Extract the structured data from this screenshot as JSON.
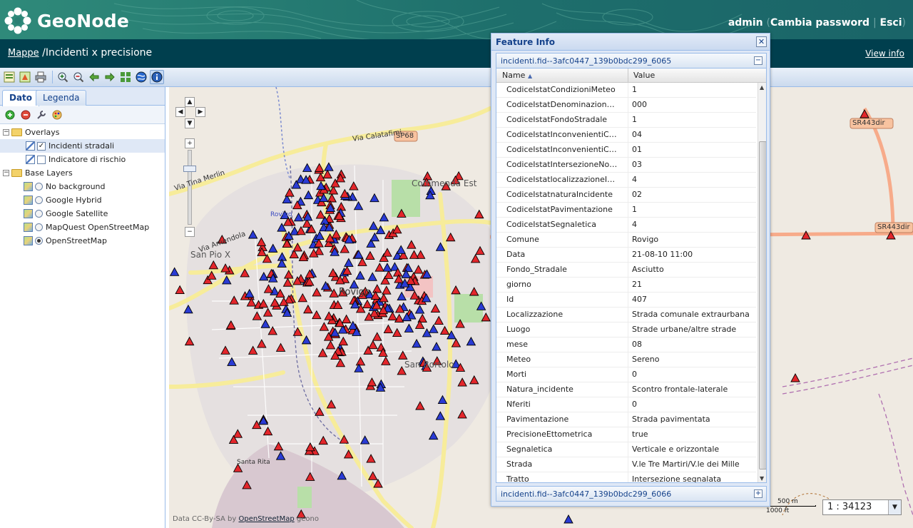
{
  "app": {
    "logo_text": "GeoNode",
    "user": "admin",
    "change_password": "Cambia password",
    "logout": "Esci"
  },
  "titlebar": {
    "breadcrumb_link": "Mappe",
    "separator": "/",
    "map_title": "Incidenti x precisione",
    "view_info": "View info"
  },
  "toolbar": {
    "buttons": [
      "print-preview",
      "export",
      "print",
      "zoom-in",
      "zoom-out",
      "back",
      "forward",
      "zoom-extent",
      "globe",
      "info"
    ]
  },
  "left_panel": {
    "tabs": [
      {
        "label": "Dato"
      },
      {
        "label": "Legenda"
      }
    ],
    "active_tab": "Dato",
    "tree": {
      "overlays_label": "Overlays",
      "overlays": [
        {
          "label": "Incidenti stradali",
          "checked": true
        },
        {
          "label": "Indicatore di rischio",
          "checked": false
        }
      ],
      "base_label": "Base Layers",
      "base": [
        {
          "label": "No background",
          "selected": false
        },
        {
          "label": "Google Hybrid",
          "selected": false
        },
        {
          "label": "Google Satellite",
          "selected": false
        },
        {
          "label": "MapQuest OpenStreetMap",
          "selected": false
        },
        {
          "label": "OpenStreetMap",
          "selected": true
        }
      ]
    }
  },
  "map": {
    "labels": {
      "via_calatafimi": "Via Calatafimi",
      "sp68": "SP68",
      "commenda_est": "Commenda Est",
      "via_merlin": "Via Tina Merlin",
      "rovigo_small": "Rovigo",
      "san_pio_x": "San Pio X",
      "rovigo": "Rovigo",
      "san_bortolo": "San Bortolo",
      "santa_rita": "Santa Rita",
      "sr443dir": "SR443dir",
      "sr443dir_2": "SR443dir",
      "amendola": "Via Amendola"
    },
    "attribution_prefix": "Data CC-By-SA by",
    "attribution_link": "OpenStreetMap",
    "attribution_suffix": "geono",
    "scale_m": "500 m",
    "scale_ft": "1000 ft",
    "scale_value": "1 : 34123",
    "colors": {
      "red_marker": "#e3262b",
      "blue_marker": "#2a3bd4"
    }
  },
  "feature_info": {
    "title": "Feature Info",
    "feature_1": "incidenti.fid--3afc0447_139b0bdc299_6065",
    "feature_2": "incidenti.fid--3afc0447_139b0bdc299_6066",
    "col_name": "Name",
    "col_value": "Value",
    "rows": [
      {
        "name": "CodiceIstatCondizioniMeteo",
        "value": "1"
      },
      {
        "name": "CodiceIstatDenominazioneStrada",
        "value": "000"
      },
      {
        "name": "CodiceIstatFondoStradale",
        "value": "1"
      },
      {
        "name": "CodiceIstatInconvenientiCircola…",
        "value": "04"
      },
      {
        "name": "CodiceIstatInconvenientiCircola…",
        "value": "01"
      },
      {
        "name": "CodiceIstatIntersezioneNonInter…",
        "value": "03"
      },
      {
        "name": "CodiceIstatlocalizzazioneIncidente",
        "value": "4"
      },
      {
        "name": "CodiceIstatnaturaIncidente",
        "value": "02"
      },
      {
        "name": "CodiceIstatPavimentazione",
        "value": "1"
      },
      {
        "name": "CodiceIstatSegnaletica",
        "value": "4"
      },
      {
        "name": "Comune",
        "value": "Rovigo"
      },
      {
        "name": "Data",
        "value": "21-08-10 11:00"
      },
      {
        "name": "Fondo_Stradale",
        "value": "Asciutto"
      },
      {
        "name": "giorno",
        "value": "21"
      },
      {
        "name": "Id",
        "value": "407"
      },
      {
        "name": "Localizzazione",
        "value": "Strada comunale extraurbana"
      },
      {
        "name": "Luogo",
        "value": "Strade urbane/altre strade"
      },
      {
        "name": "mese",
        "value": "08"
      },
      {
        "name": "Meteo",
        "value": "Sereno"
      },
      {
        "name": "Morti",
        "value": "0"
      },
      {
        "name": "Natura_incidente",
        "value": "Scontro frontale-laterale"
      },
      {
        "name": "Nferiti",
        "value": "0"
      },
      {
        "name": "Pavimentazione",
        "value": "Strada pavimentata"
      },
      {
        "name": "PrecisioneEttometrica",
        "value": "true"
      },
      {
        "name": "Segnaletica",
        "value": "Verticale e orizzontale"
      },
      {
        "name": "Strada",
        "value": "V.le Tre Martiri/V.le dei Mille"
      },
      {
        "name": "Tratto",
        "value": "Intersezione segnalata"
      }
    ]
  }
}
